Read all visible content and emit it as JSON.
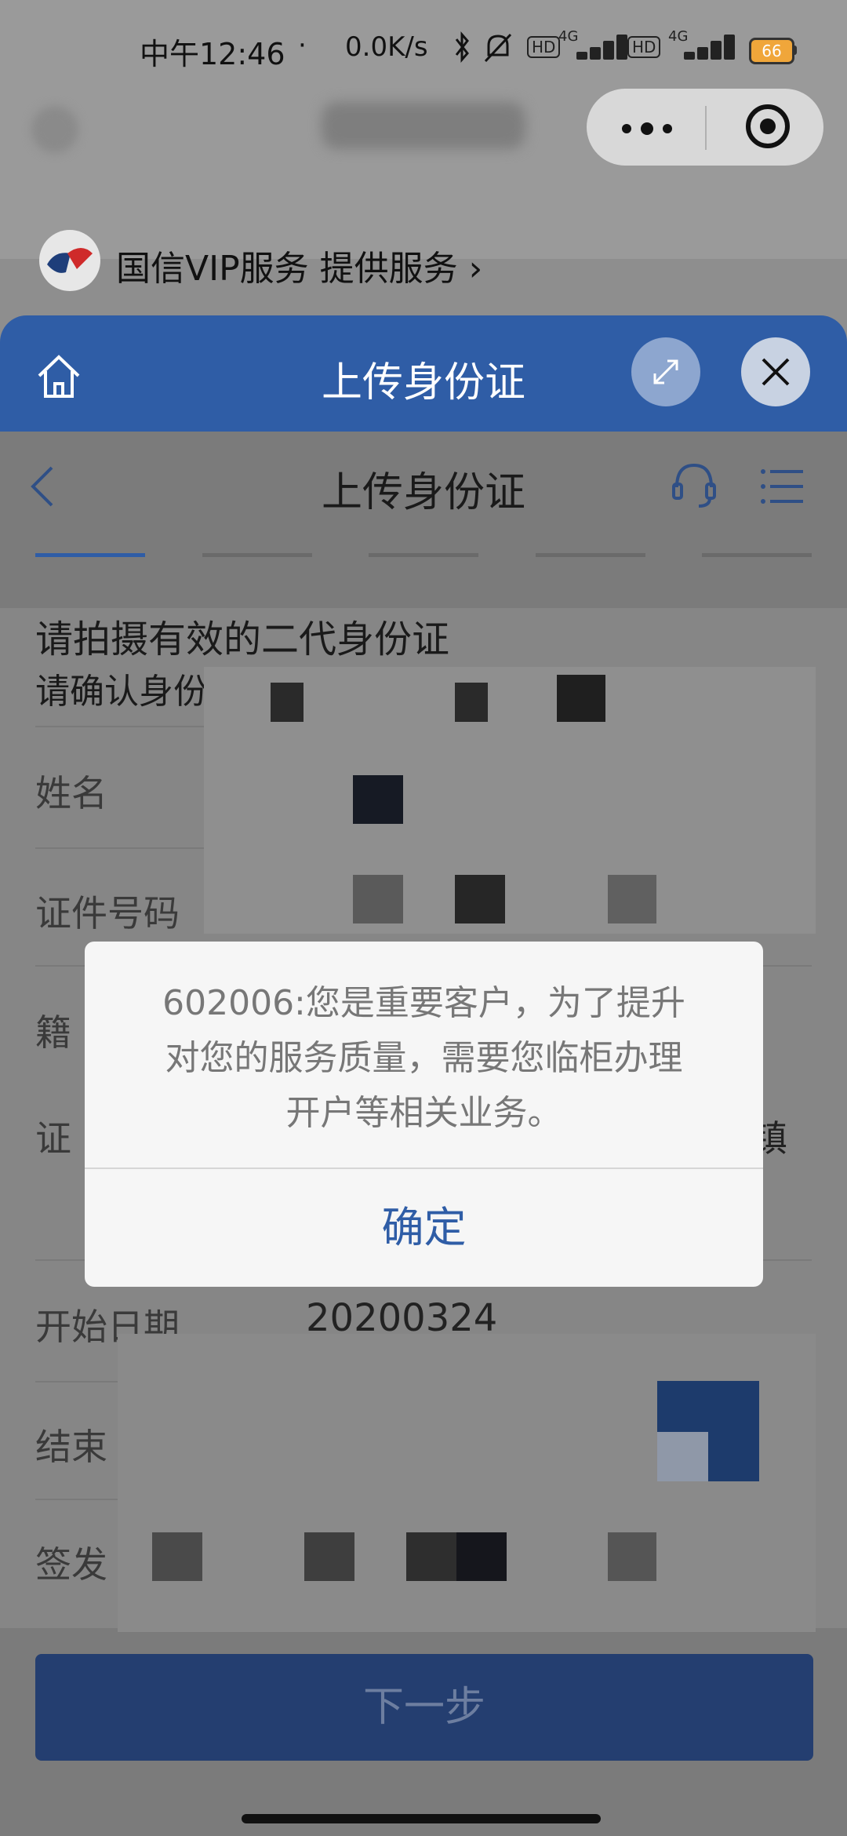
{
  "status_bar": {
    "time": "中午12:46",
    "network_speed": "0.0K/s",
    "hd_label": "HD",
    "network_type": "4G",
    "battery": "66"
  },
  "mini_program": {
    "provider_text": "国信VIP服务 提供服务"
  },
  "sheet": {
    "title": "上传身份证"
  },
  "page": {
    "title": "上传身份证",
    "instruction": "请拍摄有效的二代身份证",
    "confirm_note": "请确认身份信息，若有误请修改"
  },
  "form": {
    "fields": [
      {
        "label": "姓名"
      },
      {
        "label": "证件号码"
      },
      {
        "label": "籍"
      },
      {
        "label": "证"
      },
      {
        "label": "开始日期",
        "value": "20200324"
      },
      {
        "label": "结束"
      },
      {
        "label": "签发"
      }
    ],
    "address_suffix": "镇"
  },
  "dialog": {
    "message_line1": "602006:您是重要客户，为了提升",
    "message_line2": "对您的服务质量，需要您临柜办理",
    "message_line3": "开户等相关业务。",
    "ok_label": "确定"
  },
  "next_button": "下一步",
  "colors": {
    "brand_blue": "#2f5da6",
    "button_dark": "#243e70",
    "dialog_bg": "#f6f6f6"
  },
  "icons": [
    "bell-off-icon",
    "bluetooth-icon",
    "home-icon",
    "expand-icon",
    "close-icon",
    "back-icon",
    "headset-icon",
    "menu-icon"
  ]
}
